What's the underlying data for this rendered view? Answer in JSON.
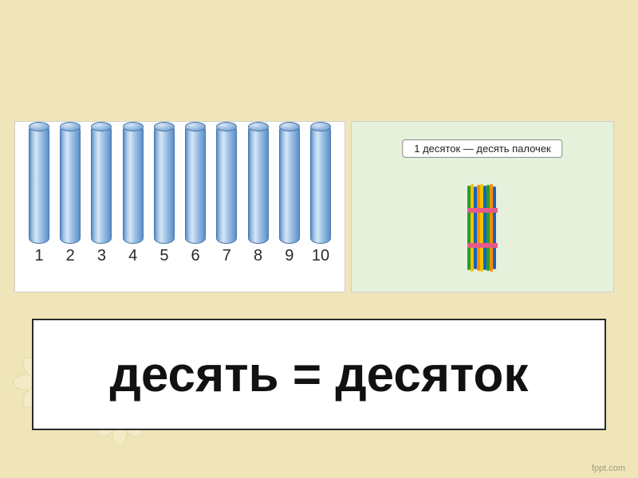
{
  "sticks": {
    "labels": [
      "1",
      "2",
      "3",
      "4",
      "5",
      "6",
      "7",
      "8",
      "9",
      "10"
    ]
  },
  "right": {
    "caption": "1 десяток — десять палочек"
  },
  "headline": "десять = десяток",
  "credit": "fppt.com"
}
